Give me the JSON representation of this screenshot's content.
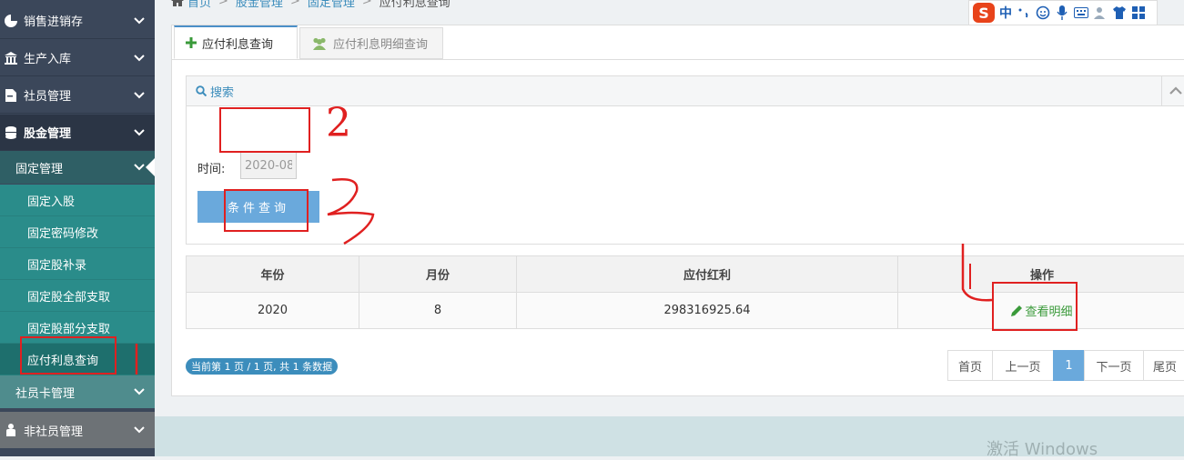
{
  "breadcrumb": {
    "home": "首页",
    "level2": "股金管理",
    "level3": "固定管理",
    "current": "应付利息查询"
  },
  "sidebar": {
    "top_items": [
      {
        "label": "销售进销存",
        "icon": "pie-chart-icon"
      },
      {
        "label": "生产入库",
        "icon": "bank-icon"
      },
      {
        "label": "社员管理",
        "icon": "document-icon"
      },
      {
        "label": "股金管理",
        "icon": "database-icon"
      }
    ],
    "sub_group": "固定管理",
    "sub_items": [
      "固定入股",
      "固定密码修改",
      "固定股补录",
      "固定股全部支取",
      "固定股部分支取",
      "应付利息查询"
    ],
    "sub_group2": "社员卡管理",
    "bottom_item": {
      "label": "非社员管理",
      "icon": "user-icon"
    }
  },
  "ime": {
    "mode": "中"
  },
  "tabs": [
    {
      "label": "应付利息查询",
      "icon": "plus-icon",
      "active": true
    },
    {
      "label": "应付利息明细查询",
      "icon": "users-icon",
      "active": false
    }
  ],
  "search": {
    "title": "搜索",
    "time_label": "时间:",
    "time_value": "2020-08",
    "button": "条件查询"
  },
  "table": {
    "headers": [
      "年份",
      "月份",
      "应付红利",
      "操作"
    ],
    "rows": [
      {
        "year": "2020",
        "month": "8",
        "amount": "298316925.64",
        "action": "查看明细"
      }
    ]
  },
  "pagination": {
    "info": "当前第 1 页 / 1 页, 共 1 条数据",
    "first": "首页",
    "prev": "上一页",
    "current": "1",
    "next": "下一页",
    "last": "尾页"
  },
  "annotations": [
    "2",
    "3",
    "1"
  ],
  "watermark": "激活 Windows",
  "colors": {
    "accent": "#3c8dbc",
    "sidebar": "#3b475a",
    "submenu": "#2a8c8a",
    "button": "#6aa9dc",
    "annotation": "#e02020",
    "link": "#3a9a3a"
  }
}
